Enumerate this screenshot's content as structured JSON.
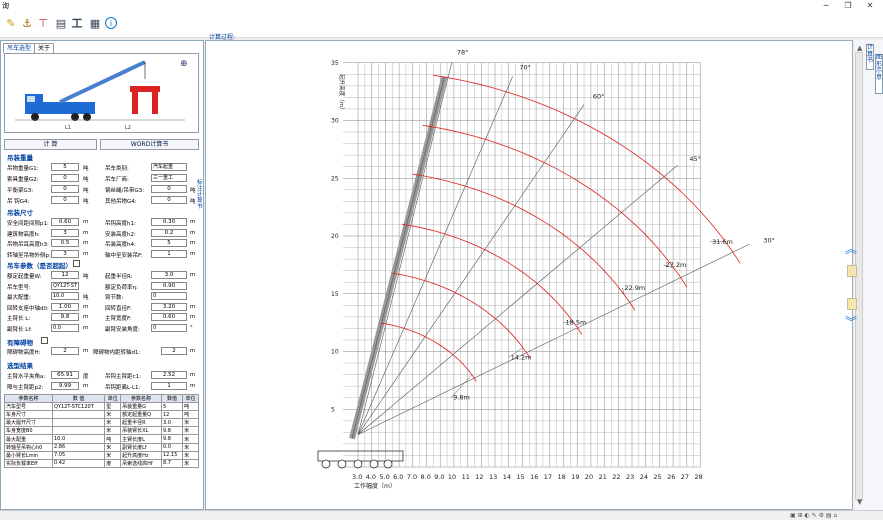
{
  "window": {
    "title": "询"
  },
  "toolbar": {
    "icons": [
      "pencil-icon",
      "hook-icon",
      "crane-icon",
      "chart-icon",
      "work-icon",
      "calculator-icon",
      "info-icon"
    ]
  },
  "tabs": [
    "吊车选型",
    "关于"
  ],
  "buttons": {
    "calc": "计  算",
    "word": "WORD计算书"
  },
  "sections": {
    "load": "吊装重量",
    "dims": "吊装尺寸",
    "crane": "吊车参数（是否超起）",
    "obstacle": "有障碍物",
    "result": "选型结果"
  },
  "load": {
    "rows": [
      {
        "l1": "吊物重量G1:",
        "v1": "5",
        "u1": "吨",
        "l2": "吊车类别:",
        "v2": "汽车起重"
      },
      {
        "l1": "索具重量G2:",
        "v1": "0",
        "u1": "吨",
        "l2": "吊车厂商:",
        "v2": "三一重工"
      },
      {
        "l1": "平衡梁G3:",
        "v1": "0",
        "u1": "吨",
        "l2": "钢丝绳/吊带G3:",
        "v2": "0",
        "u2": "吨"
      },
      {
        "l1": "吊 钩G4:",
        "v1": "0",
        "u1": "吨",
        "l2": "其他吊物G4:",
        "v2": "0",
        "u2": "吨"
      }
    ]
  },
  "dims": {
    "rows": [
      {
        "l1": "安全间距间隙p1:",
        "v1": "0.60",
        "u1": "m",
        "l2": "吊钩高度h1:",
        "v2": "0.30",
        "u2": "m"
      },
      {
        "l1": "建筑物高度h:",
        "v1": "3",
        "u1": "m",
        "l2": "安装高度h2:",
        "v2": "0.2",
        "u2": "m"
      },
      {
        "l1": "吊物吊耳高度h3:",
        "v1": "0.5",
        "u1": "m",
        "l2": "吊装高度h4:",
        "v2": "5",
        "u2": "m"
      },
      {
        "l1": "转轴至吊物外侧p:",
        "v1": "3",
        "u1": "m",
        "l2": "轴中至安装吊F:",
        "v2": "1",
        "u2": "m"
      }
    ]
  },
  "crane": {
    "rows": [
      {
        "l1": "额定起重量W:",
        "v1": "12",
        "u1": "吨",
        "l2": "起重半径R:",
        "v2": "3.0",
        "u2": "m"
      },
      {
        "l1": "吊车型号:",
        "v1": "QY12T-ST",
        "u1": "",
        "l2": "额定负荷率η:",
        "v2": "0.90",
        "u2": ""
      },
      {
        "l1": "最大配重:",
        "v1": "10.0",
        "u1": "吨",
        "l2": "臂节数:",
        "v2": "0",
        "u2": ""
      },
      {
        "l1": "回转支座中轴d0:",
        "v1": "1.00",
        "u1": "m",
        "l2": "回转直径F:",
        "v2": "3.20",
        "u2": "m"
      },
      {
        "l1": "主臂长 L:",
        "v1": "9.8",
        "u1": "m",
        "l2": "主臂宽度F:",
        "v2": "0.60",
        "u2": "m"
      },
      {
        "l1": "副臂长 Lf:",
        "v1": "0.0",
        "u1": "m",
        "l2": "副臂安装角度:",
        "v2": "0",
        "u2": "°"
      }
    ]
  },
  "obstacle": {
    "l1": "障碍物高度H:",
    "v1": "2",
    "u1": "m",
    "l2": "障碍物内距转轴d1:",
    "v2": "2",
    "u2": "m"
  },
  "result": {
    "rows": [
      {
        "l1": "主臂水平夹角a:",
        "v1": "65.91",
        "u1": "度",
        "l2": "吊钩主臂距c1:",
        "v2": "2.52",
        "u2": "m"
      },
      {
        "l1": "障与主臂距p2:",
        "v1": "9.99",
        "u1": "m",
        "l2": "吊钩距离L-L1:",
        "v2": "1",
        "u2": "m"
      }
    ],
    "table_header": [
      "参数名称",
      "数  值",
      "单位",
      "参数名称",
      "数值",
      "单位"
    ],
    "table": [
      [
        "汽车型号",
        "QY12T-STC120T",
        "型",
        "吊装重量G",
        "5",
        "吨"
      ],
      [
        "车身尺寸",
        "",
        "米",
        "额定起重量Q",
        "12",
        "吨"
      ],
      [
        "最大履开尺寸",
        "",
        "米",
        "起重半径R",
        "3.0",
        "米"
      ],
      [
        "车身宽度B0",
        "",
        "米",
        "吊装臂长XL",
        "9.8",
        "米"
      ],
      [
        "最大配重",
        "10.0",
        "吨",
        "主臂长度L",
        "9.8",
        "米"
      ],
      [
        "转轴至吊钩心h0",
        "2.86",
        "米",
        "副臂长度Lf",
        "0.0",
        "米"
      ],
      [
        "最小臂长Lmin",
        "7.05",
        "米",
        "起升高度Hz",
        "12.15",
        "米"
      ],
      [
        "实际负载率Eff",
        "0.42",
        "度",
        "吊索选线高Hf",
        "8.7",
        "米"
      ]
    ]
  },
  "side_label": "标注计算书",
  "chart_label": "计算过程:",
  "chart_data": {
    "type": "line",
    "title": "",
    "ylabel": "起升高度（m）",
    "xlabel": "工作幅度（m）",
    "x_ticks": [
      "3.0",
      "4.0",
      "5.0",
      "6.0",
      "7.0",
      "8.0",
      "9.0",
      "10",
      "11",
      "12",
      "13",
      "14",
      "15",
      "16",
      "17",
      "18",
      "19",
      "20",
      "21",
      "22",
      "23",
      "24",
      "25",
      "26",
      "27",
      "28"
    ],
    "y_ticks": [
      "0",
      "5",
      "10",
      "15",
      "20",
      "25",
      "30",
      "35"
    ],
    "ylim": [
      0,
      35
    ],
    "angle_labels": [
      "78°",
      "70°",
      "60°",
      "45°",
      "30°"
    ],
    "boom_length_labels": [
      "31.6m",
      "27.2m",
      "22.9m",
      "18.5m",
      "14.2m",
      "9.8m"
    ],
    "boom_lengths": [
      9.8,
      14.2,
      18.5,
      22.9,
      27.2,
      31.6
    ],
    "angles": [
      78,
      70,
      60,
      45,
      30
    ],
    "grid": true
  },
  "right_tabs": [
    "计算书",
    "图形示意"
  ],
  "colors": {
    "accent": "#0040a0",
    "curve": "#e02020",
    "angle_line": "#555555",
    "boom": "#888888"
  }
}
